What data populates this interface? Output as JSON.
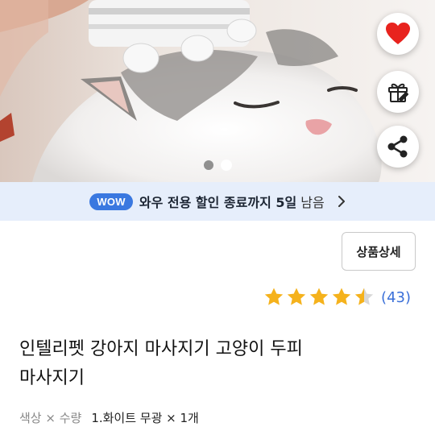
{
  "product_images": {
    "current_index": 1,
    "total": 2,
    "dots": [
      {
        "state": "active"
      },
      {
        "state": "inactive"
      }
    ]
  },
  "actions": {
    "like_icon": "heart-icon",
    "gift_icon": "gift-icon",
    "share_icon": "share-icon"
  },
  "wow_banner": {
    "badge": "WOW",
    "text": "와우 전용 할인 종료까지 5일",
    "remaining": "남음"
  },
  "detail_button": {
    "label": "상품상세"
  },
  "rating": {
    "stars": 4.5,
    "max_stars": 5,
    "review_count": "(43)"
  },
  "product": {
    "title_line1": "인텔리펫 강아지 마사지기 고양이 두피",
    "title_line2": "마사지기"
  },
  "option": {
    "label": "색상 × 수량",
    "value": "1.화이트 무광 × 1개"
  },
  "colors": {
    "heart": "#e8231e",
    "wow_badge": "#3a78e0",
    "wow_banner_bg": "#e6eefb",
    "star": "#f5b21c",
    "review_link": "#3a6fd8"
  }
}
